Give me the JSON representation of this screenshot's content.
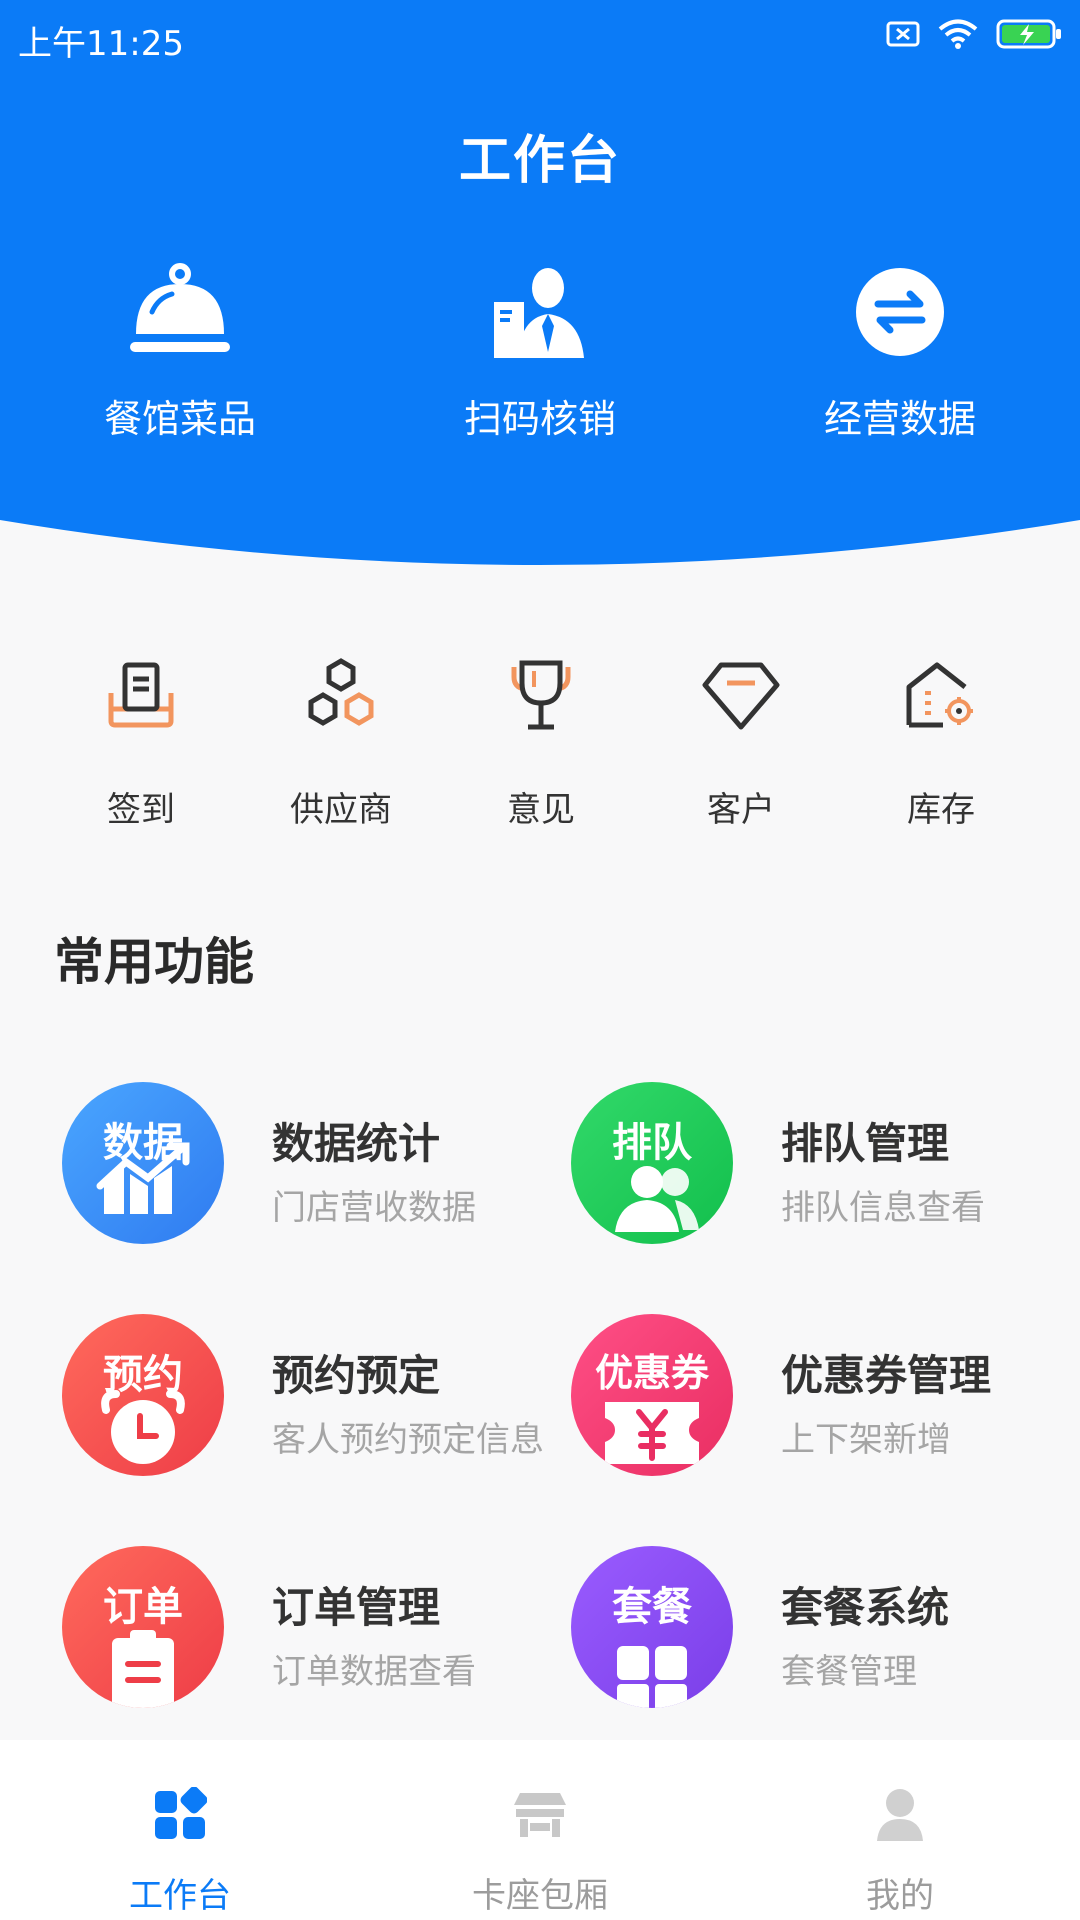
{
  "status_bar": {
    "time": "上午11:25"
  },
  "header": {
    "title": "工作台"
  },
  "colors": {
    "primary": "#0b7bf7",
    "orange": "#f2955e",
    "dark": "#333333",
    "inactive": "#9c9c9c"
  },
  "hero_actions": [
    {
      "label": "餐馆菜品",
      "icon": "cloche-icon"
    },
    {
      "label": "扫码核销",
      "icon": "staff-icon"
    },
    {
      "label": "经营数据",
      "icon": "exchange-icon"
    }
  ],
  "quick_actions": [
    {
      "label": "签到",
      "icon": "sign-in-icon"
    },
    {
      "label": "供应商",
      "icon": "supplier-icon"
    },
    {
      "label": "意见",
      "icon": "trophy-icon"
    },
    {
      "label": "客户",
      "icon": "diamond-icon"
    },
    {
      "label": "库存",
      "icon": "warehouse-icon"
    }
  ],
  "section": {
    "title": "常用功能"
  },
  "features": [
    {
      "badge": "数据",
      "title": "数据统计",
      "subtitle": "门店营收数据",
      "icon": "chart-icon",
      "color": "#3b8ef5"
    },
    {
      "badge": "排队",
      "title": "排队管理",
      "subtitle": "排队信息查看",
      "icon": "people-icon",
      "color": "#1fce5d"
    },
    {
      "badge": "预约",
      "title": "预约预定",
      "subtitle": "客人预约预定信息",
      "icon": "alarm-clock-icon",
      "color": "#f04a48"
    },
    {
      "badge": "优惠券",
      "title": "优惠券管理",
      "subtitle": "上下架新增",
      "icon": "coupon-icon",
      "color": "#f0386a"
    },
    {
      "badge": "订单",
      "title": "订单管理",
      "subtitle": "订单数据查看",
      "icon": "clipboard-icon",
      "color": "#f04a48"
    },
    {
      "badge": "套餐",
      "title": "套餐系统",
      "subtitle": "套餐管理",
      "icon": "gift-icon",
      "color": "#8a4ff0"
    }
  ],
  "tabbar": [
    {
      "label": "工作台",
      "icon": "dashboard-icon",
      "active": true
    },
    {
      "label": "卡座包厢",
      "icon": "booth-icon",
      "active": false
    },
    {
      "label": "我的",
      "icon": "user-icon",
      "active": false
    }
  ]
}
